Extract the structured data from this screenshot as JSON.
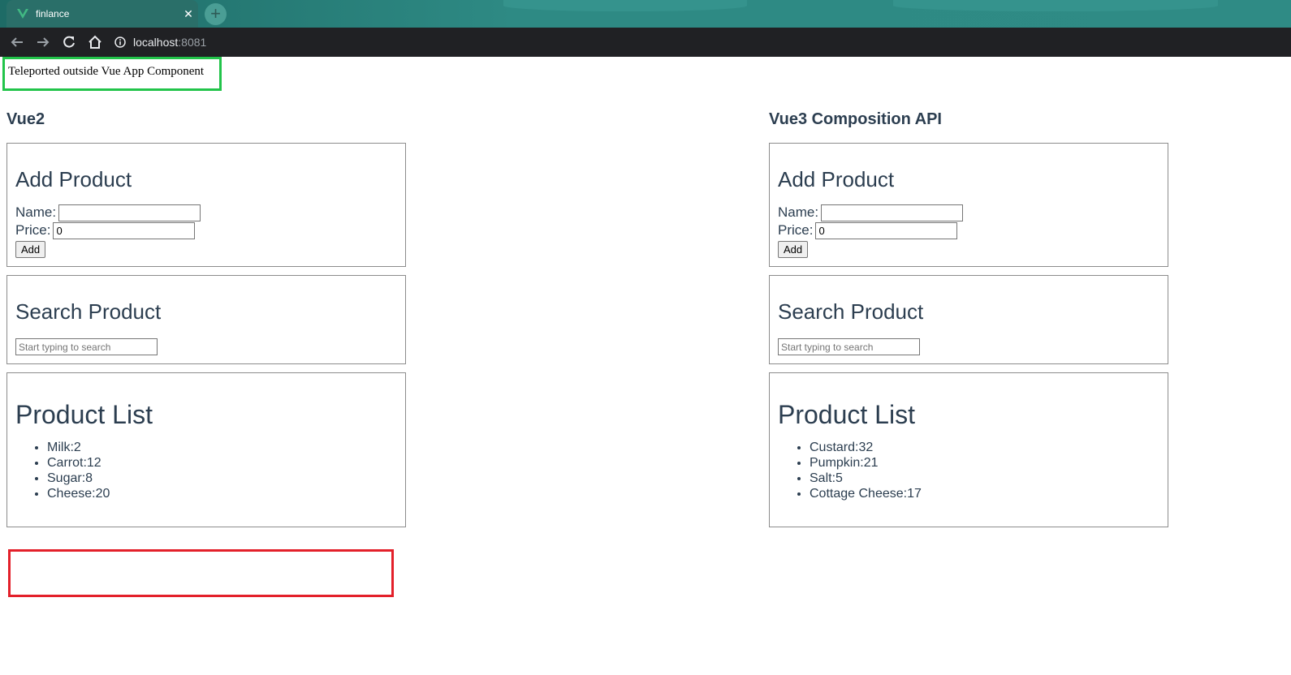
{
  "browser": {
    "tab_title": "finlance",
    "url_host": "localhost",
    "url_port": ":8081"
  },
  "teleport_text": "Teleported outside Vue App Component",
  "columns": [
    {
      "heading": "Vue2",
      "add": {
        "title": "Add Product",
        "name_label": "Name:",
        "name_value": "",
        "price_label": "Price:",
        "price_value": "0",
        "button": "Add"
      },
      "search": {
        "title": "Search Product",
        "placeholder": "Start typing to search"
      },
      "list": {
        "title": "Product List",
        "items": [
          "Milk:2",
          "Carrot:12",
          "Sugar:8",
          "Cheese:20"
        ]
      }
    },
    {
      "heading": "Vue3 Composition API",
      "add": {
        "title": "Add Product",
        "name_label": "Name:",
        "name_value": "",
        "price_label": "Price:",
        "price_value": "0",
        "button": "Add"
      },
      "search": {
        "title": "Search Product",
        "placeholder": "Start typing to search"
      },
      "list": {
        "title": "Product List",
        "items": [
          "Custard:32",
          "Pumpkin:21",
          "Salt:5",
          "Cottage Cheese:17"
        ]
      }
    }
  ],
  "colors": {
    "teleport_border": "#22c44a",
    "empty_box_border": "#e3202a",
    "text": "#2c3e50"
  }
}
